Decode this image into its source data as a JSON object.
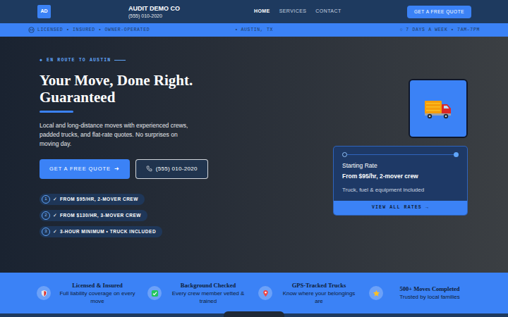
{
  "header": {
    "logo": "AD",
    "company": "AUDIT DEMO CO",
    "phone": "(555) 010-2020",
    "nav": [
      {
        "label": "HOME",
        "selected": true
      },
      {
        "label": "SERVICES",
        "selected": false
      },
      {
        "label": "CONTACT",
        "selected": false
      }
    ],
    "cta": "GET A FREE QUOTE"
  },
  "info_bar": {
    "left": "LICENSED • INSURED • OWNER-OPERATED",
    "center_icon": "•",
    "center": "AUSTIN, TX",
    "right_icon": "○",
    "right": "7 DAYS A WEEK • 7AM–7PM"
  },
  "hero": {
    "eyebrow_icon": "◆",
    "eyebrow": "EN ROUTE TO AUSTIN",
    "title": "Your Move, Done Right. Guaranteed",
    "description": "Local and long-distance moves with experienced crews, padded trucks, and flat-rate quotes. No surprises on moving day.",
    "primary_button": "GET A FREE QUOTE",
    "primary_arrow": "➜",
    "phone_button": "(555) 010-2020",
    "pills": [
      {
        "number": "1",
        "check": "✓",
        "label": "FROM $95/HR, 2-MOVER CREW"
      },
      {
        "number": "2",
        "check": "✓",
        "label": "FROM $130/HR, 3-MOVER CREW"
      },
      {
        "number": "3",
        "check": "✓",
        "label": "3-HOUR MINIMUM • TRUCK INCLUDED"
      }
    ]
  },
  "rate_card": {
    "title": "Starting Rate",
    "price": "From $95/hr, 2-mover crew",
    "note": "Truck, fuel & equipment included",
    "button": "VIEW ALL RATES →"
  },
  "features": [
    {
      "kind": "shield",
      "title": "Licensed & Insured",
      "description": "Full liability coverage on every move"
    },
    {
      "kind": "check",
      "title": "Background Checked",
      "description": "Every crew member vetted & trained"
    },
    {
      "kind": "pin",
      "title": "GPS-Tracked Trucks",
      "description": "Know where your belongings are"
    },
    {
      "kind": "star",
      "title": "500+ Moves Completed",
      "description": "Trusted by local families"
    }
  ]
}
